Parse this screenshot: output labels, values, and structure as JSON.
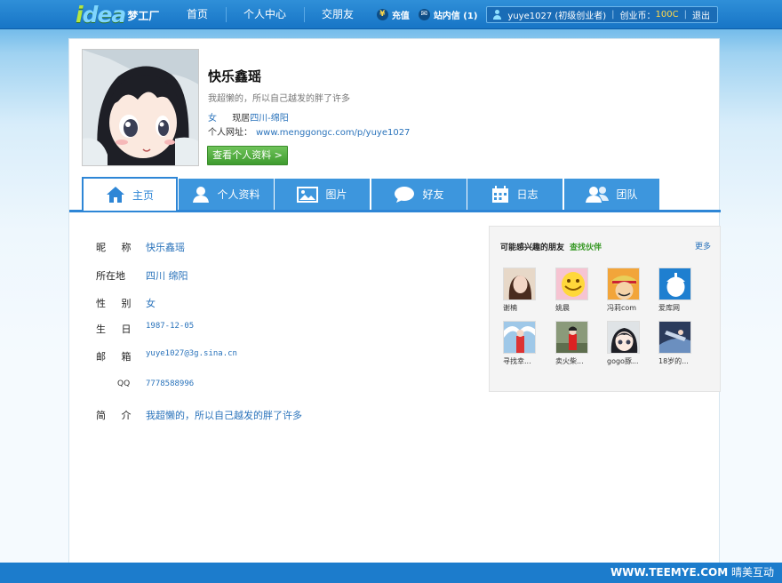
{
  "header": {
    "logo_text_1": "i",
    "logo_text_2": "dea",
    "logo_cn": "梦工厂",
    "nav": [
      "首页",
      "个人中心",
      "交朋友"
    ],
    "recharge": "充值",
    "messages": "站内信 (1)",
    "username": "yuye1027 (初级创业者)",
    "coin_label": "创业币：",
    "coin_value": "100C",
    "logout": "退出"
  },
  "profile": {
    "name": "快乐鑫瑶",
    "signature": "我超懒的，所以自己越发的胖了许多",
    "gender": "女",
    "location_label": "现居",
    "location": "四川-绵阳",
    "url_label": "个人网址：",
    "url": "www.menggongc.com/p/yuye1027",
    "view_button": "查看个人资料 >"
  },
  "tabs": [
    {
      "label": "主页",
      "icon": "home-icon"
    },
    {
      "label": "个人资料",
      "icon": "user-icon"
    },
    {
      "label": "图片",
      "icon": "picture-icon"
    },
    {
      "label": "好友",
      "icon": "chat-icon"
    },
    {
      "label": "日志",
      "icon": "calendar-icon"
    },
    {
      "label": "团队",
      "icon": "team-icon"
    }
  ],
  "info": [
    {
      "label": "昵  称",
      "value": "快乐鑫瑶"
    },
    {
      "label": "所在地",
      "value": "四川  绵阳"
    },
    {
      "label": "性  别",
      "value": "女"
    },
    {
      "label": "生  日",
      "value": "1987-12-05"
    },
    {
      "label": "邮  箱",
      "value": "yuye1027@3g.sina.cn"
    },
    {
      "label": "QQ",
      "value": "7778588996"
    },
    {
      "label": "简  介",
      "value": "我超懒的，所以自己越发的胖了许多"
    }
  ],
  "friends": {
    "title": "可能感兴趣的朋友",
    "find": "查找伙伴",
    "more": "更多",
    "items": [
      "谢楠",
      "姚晨",
      "冯莉com",
      "爱库网",
      "寻找幸...",
      "卖火柴...",
      "gogo豚...",
      "18岁的..."
    ]
  },
  "footer": {
    "site": "WWW.TEEMYE.COM",
    "brand": "晴美互动"
  },
  "colors": {
    "accent": "#2e86d6",
    "link": "#2a73bb",
    "button_green": "#4aa636"
  }
}
